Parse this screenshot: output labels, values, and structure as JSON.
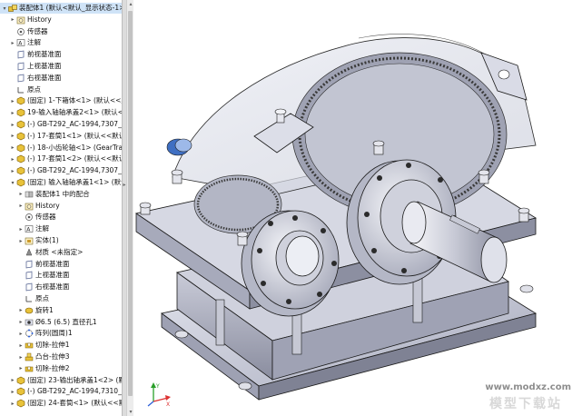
{
  "tree": {
    "items": [
      {
        "label": "装配体1 (默认<默认_显示状态-1>)",
        "icon": "assembly-icon",
        "indent": 0,
        "expander": "open",
        "selected": true
      },
      {
        "label": "History",
        "icon": "history-folder-icon",
        "indent": 1,
        "expander": "closed"
      },
      {
        "label": "传感器",
        "icon": "sensor-icon",
        "indent": 1,
        "expander": "none"
      },
      {
        "label": "注解",
        "icon": "annotation-icon",
        "indent": 1,
        "expander": "closed"
      },
      {
        "label": "前视基准面",
        "icon": "plane-icon",
        "indent": 1,
        "expander": "none"
      },
      {
        "label": "上视基准面",
        "icon": "plane-icon",
        "indent": 1,
        "expander": "none"
      },
      {
        "label": "右视基准面",
        "icon": "plane-icon",
        "indent": 1,
        "expander": "none"
      },
      {
        "label": "原点",
        "icon": "origin-icon",
        "indent": 1,
        "expander": "none"
      },
      {
        "label": "(固定) 1-下箱体<1> (默认<<默认",
        "icon": "part-icon",
        "indent": 1,
        "expander": "closed"
      },
      {
        "label": "19-输入轴轴承盖2<1> (默认<<",
        "icon": "part-icon",
        "indent": 1,
        "expander": "closed"
      },
      {
        "label": "(-) GB-T292_AC-1994,7307_AC",
        "icon": "part-icon",
        "indent": 1,
        "expander": "closed"
      },
      {
        "label": "(-) 17-套筒1<1> (默认<<默认",
        "icon": "part-icon",
        "indent": 1,
        "expander": "closed"
      },
      {
        "label": "(-) 18-小齿轮轴<1> (GearTrax<",
        "icon": "part-icon",
        "indent": 1,
        "expander": "closed"
      },
      {
        "label": "(-) 17-套筒1<2> (默认<<默认>",
        "icon": "part-icon",
        "indent": 1,
        "expander": "closed"
      },
      {
        "label": "(-) GB-T292_AC-1994,7307_AC",
        "icon": "part-icon",
        "indent": 1,
        "expander": "closed"
      },
      {
        "label": "(固定) 输入轴轴承盖1<1> (默认",
        "icon": "part-icon",
        "indent": 1,
        "expander": "open"
      },
      {
        "label": "装配体1 中的配合",
        "icon": "mates-icon",
        "indent": 2,
        "expander": "closed"
      },
      {
        "label": "History",
        "icon": "history-folder-icon",
        "indent": 2,
        "expander": "closed"
      },
      {
        "label": "传感器",
        "icon": "sensor-icon",
        "indent": 2,
        "expander": "none"
      },
      {
        "label": "注解",
        "icon": "annotation-icon",
        "indent": 2,
        "expander": "closed"
      },
      {
        "label": "实体(1)",
        "icon": "solid-bodies-icon",
        "indent": 2,
        "expander": "closed"
      },
      {
        "label": "材质 <未指定>",
        "icon": "material-icon",
        "indent": 2,
        "expander": "none"
      },
      {
        "label": "前视基准面",
        "icon": "plane-icon",
        "indent": 2,
        "expander": "none"
      },
      {
        "label": "上视基准面",
        "icon": "plane-icon",
        "indent": 2,
        "expander": "none"
      },
      {
        "label": "右视基准面",
        "icon": "plane-icon",
        "indent": 2,
        "expander": "none"
      },
      {
        "label": "原点",
        "icon": "origin-icon",
        "indent": 2,
        "expander": "none"
      },
      {
        "label": "旋转1",
        "icon": "revolve-icon",
        "indent": 2,
        "expander": "closed"
      },
      {
        "label": "Ø6.5 (6.5) 直径孔1",
        "icon": "hole-icon",
        "indent": 2,
        "expander": "closed"
      },
      {
        "label": "阵列(圆周)1",
        "icon": "pattern-icon",
        "indent": 2,
        "expander": "closed"
      },
      {
        "label": "切除-拉伸1",
        "icon": "cut-extrude-icon",
        "indent": 2,
        "expander": "closed"
      },
      {
        "label": "凸台-拉伸3",
        "icon": "boss-extrude-icon",
        "indent": 2,
        "expander": "closed"
      },
      {
        "label": "切除-拉伸2",
        "icon": "cut-extrude-icon",
        "indent": 2,
        "expander": "closed"
      },
      {
        "label": "(固定) 23-输出轴承盖1<2> (默认",
        "icon": "part-icon",
        "indent": 1,
        "expander": "closed"
      },
      {
        "label": "(-) GB-T292_AC-1994,7310_AC",
        "icon": "part-icon",
        "indent": 1,
        "expander": "closed"
      },
      {
        "label": "(固定) 24-套筒<1> (默认<<默认",
        "icon": "part-icon",
        "indent": 1,
        "expander": "closed"
      }
    ]
  },
  "viewport": {
    "watermark": "www.modxz.com",
    "watermark_sub": "模型下载站"
  },
  "triad": {
    "x_label": "X",
    "y_label": "Y",
    "z_label": "Z"
  },
  "colors": {
    "selection": "#cfe3f7",
    "part_yellow": "#e8c23a",
    "metal_light": "#d9dbe6",
    "metal_mid": "#b7bacb",
    "metal_dark": "#7d8091",
    "edge": "#1a1a1a"
  }
}
